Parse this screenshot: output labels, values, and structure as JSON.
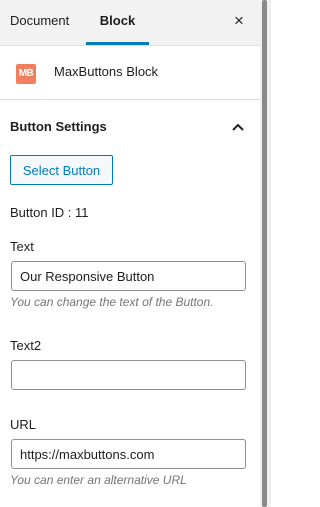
{
  "tabs": {
    "document": "Document",
    "block": "Block",
    "close": "×"
  },
  "block": {
    "logo": "MB",
    "title": "MaxButtons Block",
    "accent": "#f07f5f"
  },
  "panel": {
    "title": "Button Settings",
    "select_button": "Select Button",
    "button_id": "Button ID : 11",
    "text": {
      "label": "Text",
      "value": "Our Responsive Button",
      "help": "You can change the text of the Button."
    },
    "text2": {
      "label": "Text2",
      "value": ""
    },
    "url": {
      "label": "URL",
      "value": "https://maxbuttons.com",
      "help": "You can enter an alternative URL"
    }
  },
  "colors": {
    "primary": "#007cba",
    "help_text": "#757575"
  }
}
